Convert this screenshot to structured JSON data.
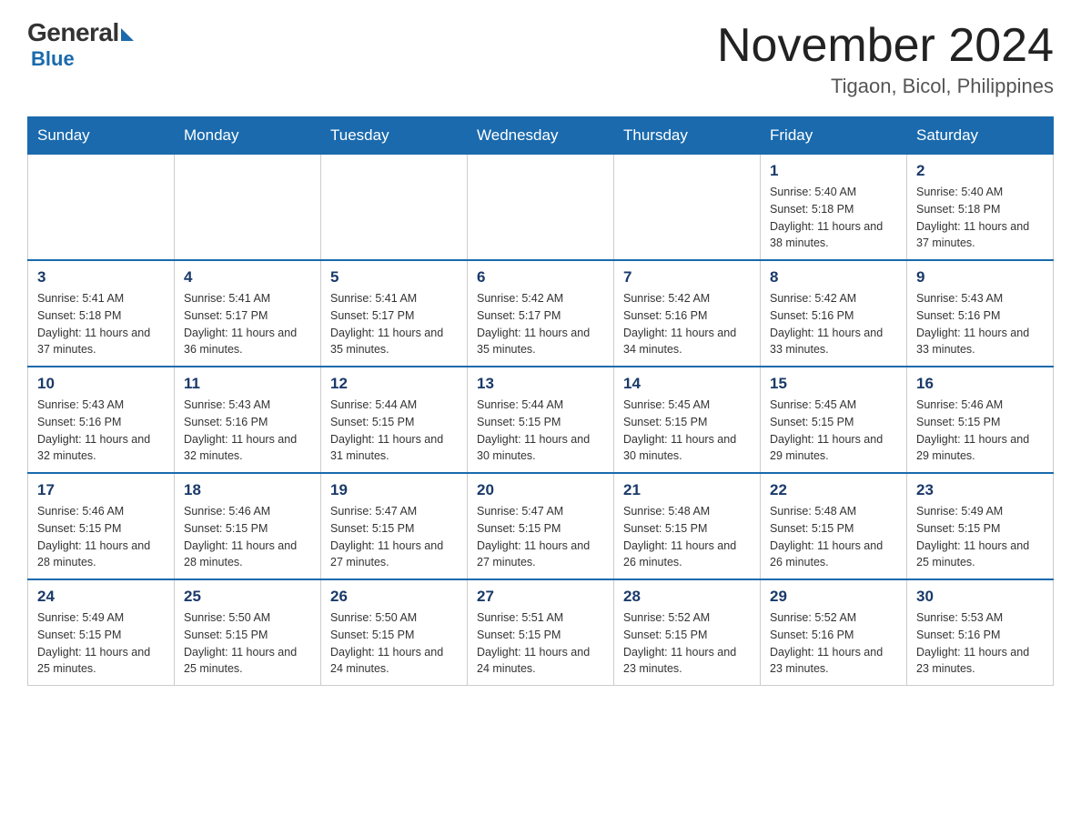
{
  "logo": {
    "general": "General",
    "blue": "Blue"
  },
  "header": {
    "month_year": "November 2024",
    "location": "Tigaon, Bicol, Philippines"
  },
  "weekdays": [
    "Sunday",
    "Monday",
    "Tuesday",
    "Wednesday",
    "Thursday",
    "Friday",
    "Saturday"
  ],
  "weeks": [
    {
      "days": [
        {
          "num": "",
          "info": ""
        },
        {
          "num": "",
          "info": ""
        },
        {
          "num": "",
          "info": ""
        },
        {
          "num": "",
          "info": ""
        },
        {
          "num": "",
          "info": ""
        },
        {
          "num": "1",
          "info": "Sunrise: 5:40 AM\nSunset: 5:18 PM\nDaylight: 11 hours and 38 minutes."
        },
        {
          "num": "2",
          "info": "Sunrise: 5:40 AM\nSunset: 5:18 PM\nDaylight: 11 hours and 37 minutes."
        }
      ]
    },
    {
      "days": [
        {
          "num": "3",
          "info": "Sunrise: 5:41 AM\nSunset: 5:18 PM\nDaylight: 11 hours and 37 minutes."
        },
        {
          "num": "4",
          "info": "Sunrise: 5:41 AM\nSunset: 5:17 PM\nDaylight: 11 hours and 36 minutes."
        },
        {
          "num": "5",
          "info": "Sunrise: 5:41 AM\nSunset: 5:17 PM\nDaylight: 11 hours and 35 minutes."
        },
        {
          "num": "6",
          "info": "Sunrise: 5:42 AM\nSunset: 5:17 PM\nDaylight: 11 hours and 35 minutes."
        },
        {
          "num": "7",
          "info": "Sunrise: 5:42 AM\nSunset: 5:16 PM\nDaylight: 11 hours and 34 minutes."
        },
        {
          "num": "8",
          "info": "Sunrise: 5:42 AM\nSunset: 5:16 PM\nDaylight: 11 hours and 33 minutes."
        },
        {
          "num": "9",
          "info": "Sunrise: 5:43 AM\nSunset: 5:16 PM\nDaylight: 11 hours and 33 minutes."
        }
      ]
    },
    {
      "days": [
        {
          "num": "10",
          "info": "Sunrise: 5:43 AM\nSunset: 5:16 PM\nDaylight: 11 hours and 32 minutes."
        },
        {
          "num": "11",
          "info": "Sunrise: 5:43 AM\nSunset: 5:16 PM\nDaylight: 11 hours and 32 minutes."
        },
        {
          "num": "12",
          "info": "Sunrise: 5:44 AM\nSunset: 5:15 PM\nDaylight: 11 hours and 31 minutes."
        },
        {
          "num": "13",
          "info": "Sunrise: 5:44 AM\nSunset: 5:15 PM\nDaylight: 11 hours and 30 minutes."
        },
        {
          "num": "14",
          "info": "Sunrise: 5:45 AM\nSunset: 5:15 PM\nDaylight: 11 hours and 30 minutes."
        },
        {
          "num": "15",
          "info": "Sunrise: 5:45 AM\nSunset: 5:15 PM\nDaylight: 11 hours and 29 minutes."
        },
        {
          "num": "16",
          "info": "Sunrise: 5:46 AM\nSunset: 5:15 PM\nDaylight: 11 hours and 29 minutes."
        }
      ]
    },
    {
      "days": [
        {
          "num": "17",
          "info": "Sunrise: 5:46 AM\nSunset: 5:15 PM\nDaylight: 11 hours and 28 minutes."
        },
        {
          "num": "18",
          "info": "Sunrise: 5:46 AM\nSunset: 5:15 PM\nDaylight: 11 hours and 28 minutes."
        },
        {
          "num": "19",
          "info": "Sunrise: 5:47 AM\nSunset: 5:15 PM\nDaylight: 11 hours and 27 minutes."
        },
        {
          "num": "20",
          "info": "Sunrise: 5:47 AM\nSunset: 5:15 PM\nDaylight: 11 hours and 27 minutes."
        },
        {
          "num": "21",
          "info": "Sunrise: 5:48 AM\nSunset: 5:15 PM\nDaylight: 11 hours and 26 minutes."
        },
        {
          "num": "22",
          "info": "Sunrise: 5:48 AM\nSunset: 5:15 PM\nDaylight: 11 hours and 26 minutes."
        },
        {
          "num": "23",
          "info": "Sunrise: 5:49 AM\nSunset: 5:15 PM\nDaylight: 11 hours and 25 minutes."
        }
      ]
    },
    {
      "days": [
        {
          "num": "24",
          "info": "Sunrise: 5:49 AM\nSunset: 5:15 PM\nDaylight: 11 hours and 25 minutes."
        },
        {
          "num": "25",
          "info": "Sunrise: 5:50 AM\nSunset: 5:15 PM\nDaylight: 11 hours and 25 minutes."
        },
        {
          "num": "26",
          "info": "Sunrise: 5:50 AM\nSunset: 5:15 PM\nDaylight: 11 hours and 24 minutes."
        },
        {
          "num": "27",
          "info": "Sunrise: 5:51 AM\nSunset: 5:15 PM\nDaylight: 11 hours and 24 minutes."
        },
        {
          "num": "28",
          "info": "Sunrise: 5:52 AM\nSunset: 5:15 PM\nDaylight: 11 hours and 23 minutes."
        },
        {
          "num": "29",
          "info": "Sunrise: 5:52 AM\nSunset: 5:16 PM\nDaylight: 11 hours and 23 minutes."
        },
        {
          "num": "30",
          "info": "Sunrise: 5:53 AM\nSunset: 5:16 PM\nDaylight: 11 hours and 23 minutes."
        }
      ]
    }
  ]
}
